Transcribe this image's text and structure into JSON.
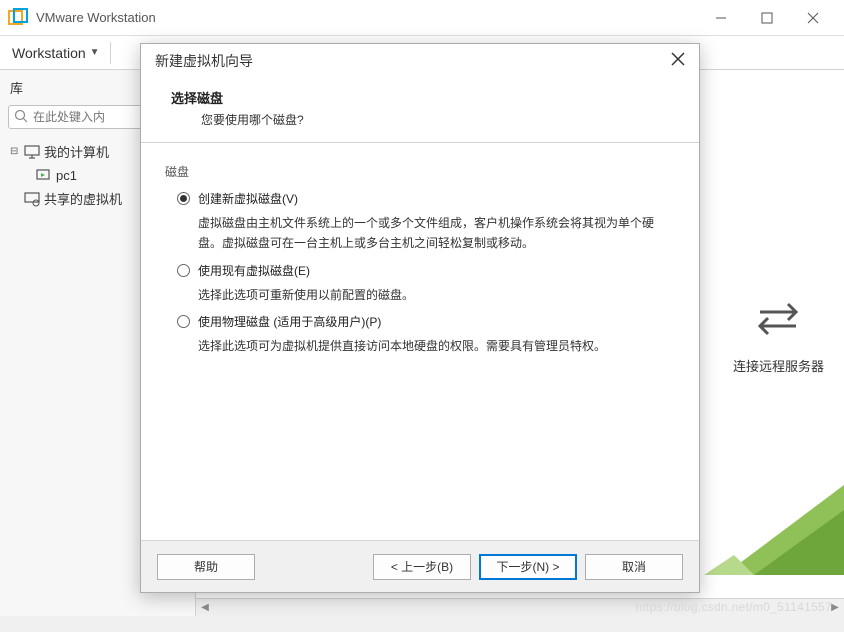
{
  "main": {
    "title": "VMware Workstation",
    "menu": "Workstation"
  },
  "sidebar": {
    "title": "库",
    "search_placeholder": "在此处键入内",
    "tree": {
      "root": "我的计算机",
      "child1": "pc1",
      "child2": "共享的虚拟机"
    }
  },
  "content": {
    "remote_label": "连接远程服务器"
  },
  "wizard": {
    "title": "新建虚拟机向导",
    "header": {
      "title": "选择磁盘",
      "subtitle": "您要使用哪个磁盘?"
    },
    "group_label": "磁盘",
    "options": [
      {
        "label": "创建新虚拟磁盘(V)",
        "desc": "虚拟磁盘由主机文件系统上的一个或多个文件组成，客户机操作系统会将其视为单个硬盘。虚拟磁盘可在一台主机上或多台主机之间轻松复制或移动。",
        "checked": true
      },
      {
        "label": "使用现有虚拟磁盘(E)",
        "desc": "选择此选项可重新使用以前配置的磁盘。",
        "checked": false
      },
      {
        "label": "使用物理磁盘 (适用于高级用户)(P)",
        "desc": "选择此选项可为虚拟机提供直接访问本地硬盘的权限。需要具有管理员特权。",
        "checked": false
      }
    ],
    "buttons": {
      "help": "帮助",
      "back": "< 上一步(B)",
      "next": "下一步(N) >",
      "cancel": "取消"
    }
  },
  "watermark": "https://blog.csdn.net/m0_51141557"
}
